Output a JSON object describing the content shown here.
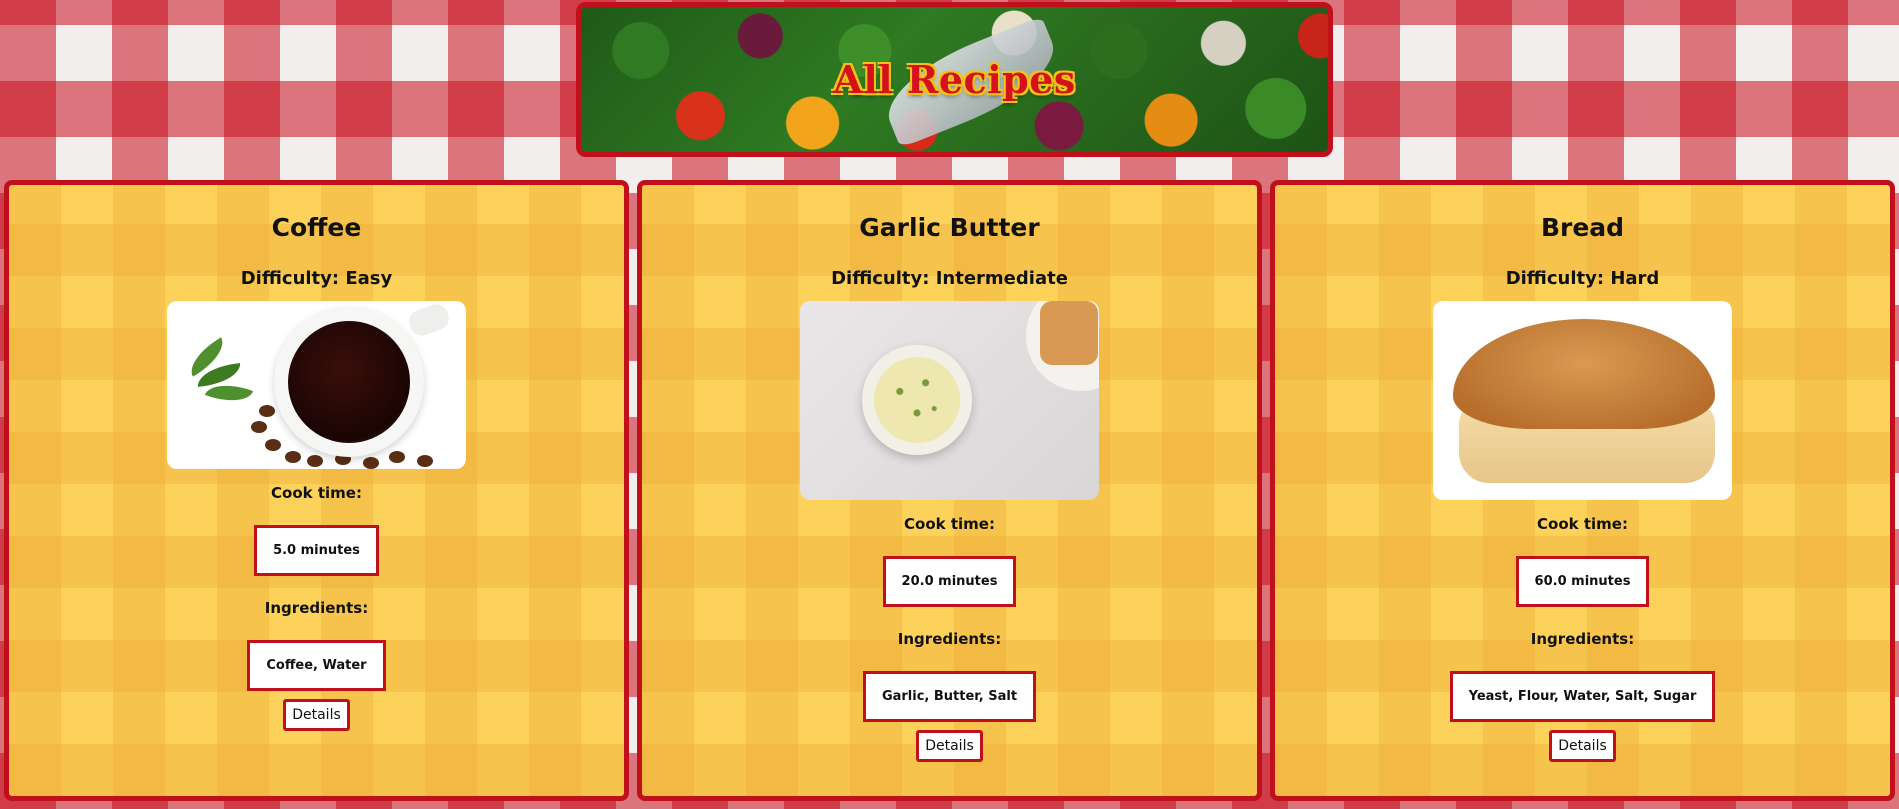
{
  "header": {
    "title": "All Recipes"
  },
  "recipes": [
    {
      "title": "Coffee",
      "difficulty": "Difficulty: Easy",
      "image": "coffee-photo",
      "cook_label": "Cook time:",
      "cook_time": "5.0 minutes",
      "ingredients_label": "Ingredients:",
      "ingredients": "Coffee, Water",
      "details_label": "Details"
    },
    {
      "title": "Garlic Butter",
      "difficulty": "Difficulty: Intermediate",
      "image": "garlic-butter-photo",
      "cook_label": "Cook time:",
      "cook_time": "20.0 minutes",
      "ingredients_label": "Ingredients:",
      "ingredients": "Garlic, Butter, Salt",
      "details_label": "Details"
    },
    {
      "title": "Bread",
      "difficulty": "Difficulty: Hard",
      "image": "bread-photo",
      "cook_label": "Cook time:",
      "cook_time": "60.0 minutes",
      "ingredients_label": "Ingredients:",
      "ingredients": "Yeast, Flour, Water, Salt, Sugar",
      "details_label": "Details"
    }
  ],
  "colors": {
    "accent_red": "#c0101c",
    "card_yellow": "#fcd25a",
    "box_white": "#ffffff"
  }
}
